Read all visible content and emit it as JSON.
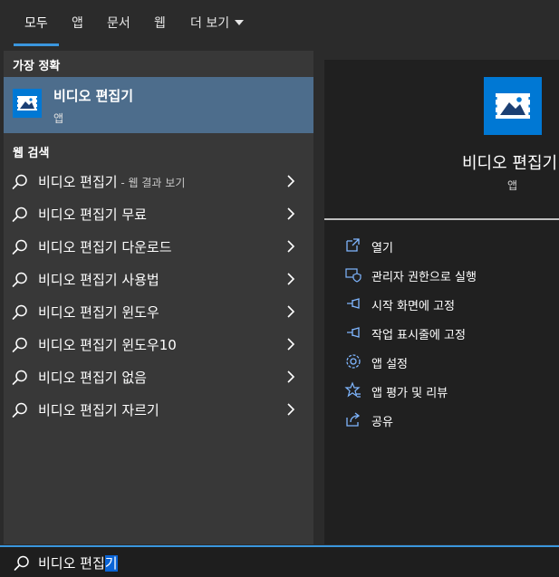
{
  "tabs": [
    {
      "label": "모두"
    },
    {
      "label": "앱"
    },
    {
      "label": "문서"
    },
    {
      "label": "웹"
    },
    {
      "label": "더 보기"
    }
  ],
  "best_match": {
    "section_title": "가장 정확",
    "name": "비디오 편집기",
    "type": "앱"
  },
  "web_search": {
    "section_title": "웹 검색",
    "items": [
      {
        "label": "비디오 편집기",
        "suffix": " - 웹 결과 보기"
      },
      {
        "label": "비디오 편집기 무료",
        "suffix": ""
      },
      {
        "label": "비디오 편집기 다운로드",
        "suffix": ""
      },
      {
        "label": "비디오 편집기 사용법",
        "suffix": ""
      },
      {
        "label": "비디오 편집기 윈도우",
        "suffix": ""
      },
      {
        "label": "비디오 편집기 윈도우10",
        "suffix": ""
      },
      {
        "label": "비디오 편집기 없음",
        "suffix": ""
      },
      {
        "label": "비디오 편집기 자르기",
        "suffix": ""
      }
    ]
  },
  "detail": {
    "name": "비디오 편집기",
    "type": "앱",
    "actions": [
      {
        "label": "열기",
        "icon": "open-icon"
      },
      {
        "label": "관리자 권한으로 실행",
        "icon": "admin-shield-icon"
      },
      {
        "label": "시작 화면에 고정",
        "icon": "pin-icon"
      },
      {
        "label": "작업 표시줄에 고정",
        "icon": "pin-icon"
      },
      {
        "label": "앱 설정",
        "icon": "gear-icon"
      },
      {
        "label": "앱 평가 및 리뷰",
        "icon": "star-icon"
      },
      {
        "label": "공유",
        "icon": "share-icon"
      }
    ]
  },
  "search": {
    "query_prefix": "비디오 편집",
    "query_selected": "기"
  },
  "colors": {
    "accent": "#3a96dd",
    "selection": "#4d6d8c",
    "app_tile": "#0078d4"
  }
}
